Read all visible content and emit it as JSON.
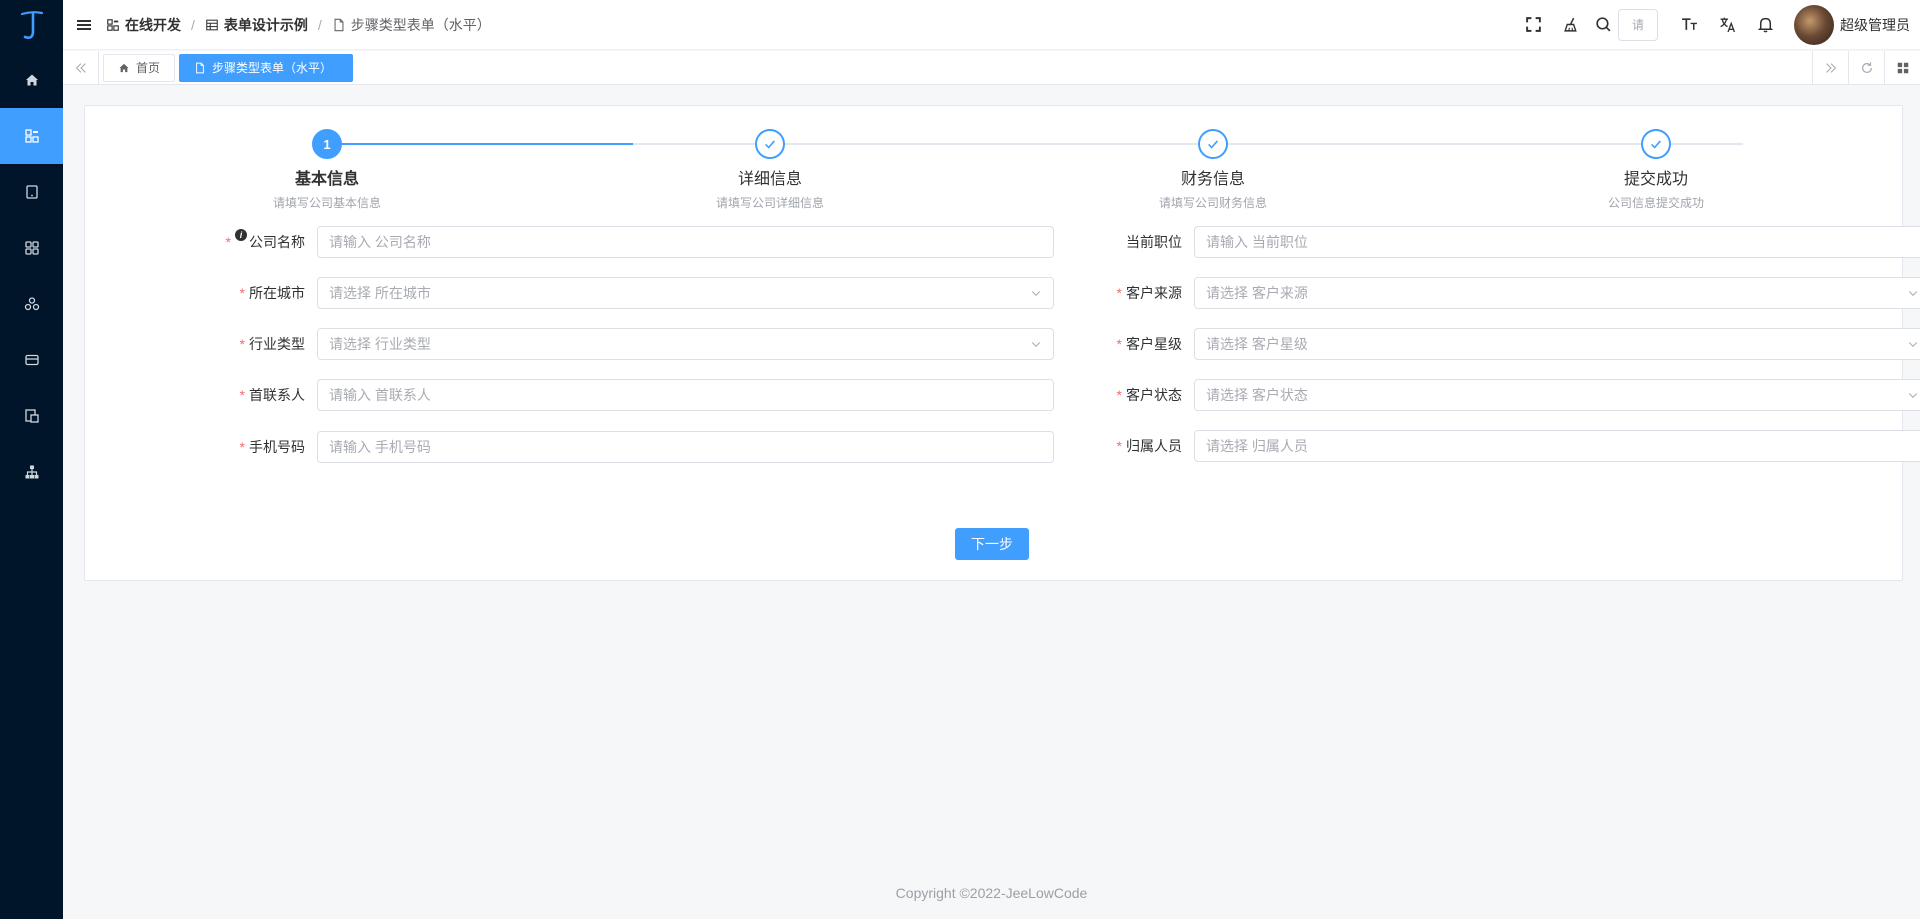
{
  "header": {
    "breadcrumbs": [
      "在线开发",
      "表单设计示例",
      "步骤类型表单（水平）"
    ],
    "separator": "/",
    "search_placeholder": "请",
    "username": "超级管理员"
  },
  "tabs": [
    {
      "label": "首页",
      "active": false
    },
    {
      "label": "步骤类型表单（水平）",
      "active": true
    }
  ],
  "sidebar": {
    "items": [
      "home-icon",
      "grid-apps-icon",
      "tablet-icon",
      "modules-icon",
      "cluster-icon",
      "card-icon",
      "files-icon",
      "org-tree-icon"
    ],
    "active_index": 1
  },
  "steps": [
    {
      "index": "1",
      "title": "基本信息",
      "desc": "请填写公司基本信息",
      "status": "active"
    },
    {
      "title": "详细信息",
      "desc": "请填写公司详细信息",
      "status": "done"
    },
    {
      "title": "财务信息",
      "desc": "请填写公司财务信息",
      "status": "done"
    },
    {
      "title": "提交成功",
      "desc": "公司信息提交成功",
      "status": "done"
    }
  ],
  "form": {
    "left": [
      {
        "label": "公司名称",
        "required": true,
        "info": true,
        "placeholder": "请输入 公司名称",
        "type": "input"
      },
      {
        "label": "所在城市",
        "required": true,
        "placeholder": "请选择 所在城市",
        "type": "select"
      },
      {
        "label": "行业类型",
        "required": true,
        "placeholder": "请选择 行业类型",
        "type": "select"
      },
      {
        "label": "首联系人",
        "required": true,
        "placeholder": "请输入 首联系人",
        "type": "input"
      },
      {
        "label": "手机号码",
        "required": true,
        "placeholder": "请输入 手机号码",
        "type": "input"
      }
    ],
    "right": [
      {
        "label": "当前职位",
        "required": false,
        "placeholder": "请输入 当前职位",
        "type": "input"
      },
      {
        "label": "客户来源",
        "required": true,
        "placeholder": "请选择 客户来源",
        "type": "select"
      },
      {
        "label": "客户星级",
        "required": true,
        "placeholder": "请选择 客户星级",
        "type": "select"
      },
      {
        "label": "客户状态",
        "required": true,
        "placeholder": "请选择 客户状态",
        "type": "select"
      },
      {
        "label": "归属人员",
        "required": true,
        "placeholder": "请选择 归属人员",
        "type": "input"
      }
    ]
  },
  "actions": {
    "next_label": "下一步"
  },
  "footer": {
    "copyright": "Copyright ©2022-JeeLowCode"
  },
  "colors": {
    "primary": "#409eff",
    "sidebar_bg": "#001529",
    "required": "#f56c6c"
  }
}
